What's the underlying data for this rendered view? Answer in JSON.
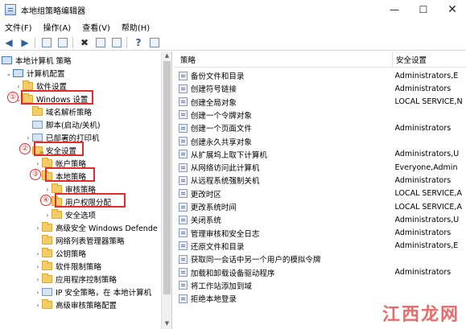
{
  "window": {
    "title": "本地组策略编辑器"
  },
  "menu": [
    "文件(F)",
    "操作(A)",
    "查看(V)",
    "帮助(H)"
  ],
  "tree": [
    {
      "label": "本地计算机 策略",
      "icon": "pc",
      "chevron": ""
    },
    {
      "label": "计算机配置",
      "icon": "pc",
      "chevron": "⌄"
    },
    {
      "label": "软件设置",
      "icon": "folder",
      "chevron": "›"
    },
    {
      "label": "Windows 设置",
      "icon": "folder",
      "chevron": "⌄"
    },
    {
      "label": "域名解析策略",
      "icon": "folder",
      "chevron": ""
    },
    {
      "label": "脚本(启动/关机)",
      "icon": "gear",
      "chevron": ""
    },
    {
      "label": "已部署的打印机",
      "icon": "gear",
      "chevron": "›"
    },
    {
      "label": "安全设置",
      "icon": "lock",
      "chevron": "⌄"
    },
    {
      "label": "帐户策略",
      "icon": "folder",
      "chevron": "›"
    },
    {
      "label": "本地策略",
      "icon": "folder",
      "chevron": "⌄"
    },
    {
      "label": "审核策略",
      "icon": "folder",
      "chevron": "›"
    },
    {
      "label": "用户权限分配",
      "icon": "folder",
      "chevron": ""
    },
    {
      "label": "安全选项",
      "icon": "folder",
      "chevron": "›"
    },
    {
      "label": "高级安全 Windows Defende",
      "icon": "folder",
      "chevron": "›"
    },
    {
      "label": "网络列表管理器策略",
      "icon": "folder",
      "chevron": ""
    },
    {
      "label": "公钥策略",
      "icon": "folder",
      "chevron": "›"
    },
    {
      "label": "软件限制策略",
      "icon": "folder",
      "chevron": "›"
    },
    {
      "label": "应用程序控制策略",
      "icon": "folder",
      "chevron": "›"
    },
    {
      "label": "IP 安全策略，在 本地计算机",
      "icon": "gear",
      "chevron": "›"
    },
    {
      "label": "高级审核策略配置",
      "icon": "folder",
      "chevron": "›"
    }
  ],
  "annotations": [
    "①",
    "②",
    "③",
    "④"
  ],
  "columns": {
    "policy": "策略",
    "setting": "安全设置"
  },
  "policies": [
    {
      "name": "备份文件和目录",
      "value": "Administrators,E"
    },
    {
      "name": "创建符号链接",
      "value": "Administrators"
    },
    {
      "name": "创建全局对象",
      "value": "LOCAL SERVICE,N"
    },
    {
      "name": "创建一个令牌对象",
      "value": ""
    },
    {
      "name": "创建一个页面文件",
      "value": "Administrators"
    },
    {
      "name": "创建永久共享对象",
      "value": ""
    },
    {
      "name": "从扩展坞上取下计算机",
      "value": "Administrators,U"
    },
    {
      "name": "从网络访问此计算机",
      "value": "Everyone,Admin"
    },
    {
      "name": "从远程系统强制关机",
      "value": "Administrators"
    },
    {
      "name": "更改时区",
      "value": "LOCAL SERVICE,A"
    },
    {
      "name": "更改系统时间",
      "value": "LOCAL SERVICE,A"
    },
    {
      "name": "关闭系统",
      "value": "Administrators,U"
    },
    {
      "name": "管理审核和安全日志",
      "value": "Administrators"
    },
    {
      "name": "还原文件和目录",
      "value": "Administrators,E"
    },
    {
      "name": "获取同一会话中另一个用户的模拟令牌",
      "value": ""
    },
    {
      "name": "加载和卸载设备驱动程序",
      "value": "Administrators"
    },
    {
      "name": "将工作站添加到域",
      "value": ""
    },
    {
      "name": "拒绝本地登录",
      "value": ""
    }
  ],
  "watermark": "江西龙网"
}
